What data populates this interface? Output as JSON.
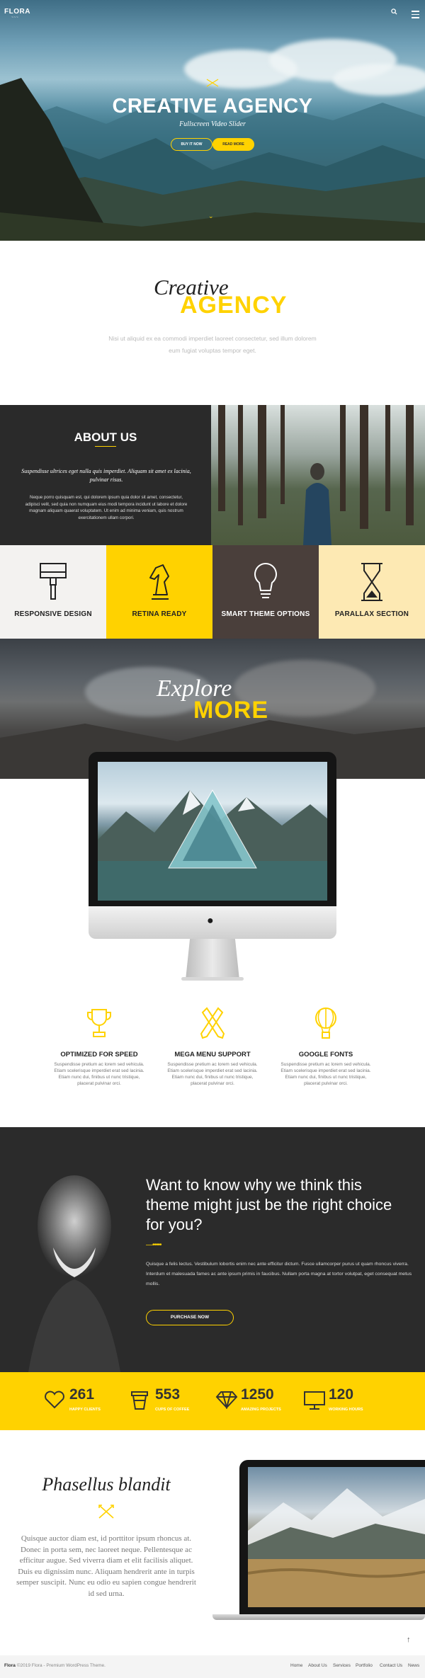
{
  "header": {
    "logo": "FLORA",
    "logo_sub": "~~~",
    "search_icon": "search-icon",
    "menu_icon": "hamburger-icon"
  },
  "hero": {
    "title": "CREATIVE AGENCY",
    "subtitle": "Fullscreen Video Slider",
    "btn_primary": "BUY IT NOW",
    "btn_secondary": "READ MORE",
    "scroll_icon": "chevron-down-icon"
  },
  "creative": {
    "line1": "Creative",
    "line2": "AGENCY",
    "text": "Nisi ut aliquid ex ea commodi imperdiet laoreet consectetur, sed illum dolorem eum fugiat voluptas tempor eget."
  },
  "about": {
    "title": "ABOUT US",
    "subtitle": "Suspendisse ultrices eget nulla quis imperdiet. Aliquam sit amet ex lacinia, pulvinar risus.",
    "body": "Neque porro quisquam est, qui dolorem ipsum quia dolor sit amet, consectetur, adipisci velit, sed quia non numquam eius modi tempora incidunt ut labore et dolore magnam aliquam quaerat voluptatem. Ut enim ad minima veniam, quis nostrum exercitationem ullam corpori."
  },
  "features": [
    {
      "label": "RESPONSIVE DESIGN",
      "icon": "paintbrush-icon",
      "bg": "#f3f2f0",
      "color": "#222"
    },
    {
      "label": "RETINA READY",
      "icon": "chess-knight-icon",
      "bg": "#ffd200",
      "color": "#222"
    },
    {
      "label": "SMART THEME OPTIONS",
      "icon": "lightbulb-icon",
      "bg": "#4a3f3b",
      "color": "#fff"
    },
    {
      "label": "PARALLAX SECTION",
      "icon": "hourglass-icon",
      "bg": "#fde9b3",
      "color": "#222"
    }
  ],
  "explore": {
    "line1": "Explore",
    "line2": "MORE"
  },
  "icon_features": [
    {
      "title": "OPTIMIZED FOR SPEED",
      "icon": "trophy-icon",
      "text": "Suspendisse pretium ac lorem sed vehicula. Etiam scelerisque imperdiet erat sed lacinia. Etiam nunc dui, finibus ut nunc tristique, placerat pulvinar orci."
    },
    {
      "title": "MEGA MENU SUPPORT",
      "icon": "pencil-ruler-icon",
      "text": "Suspendisse pretium ac lorem sed vehicula. Etiam scelerisque imperdiet erat sed lacinia. Etiam nunc dui, finibus ut nunc tristique, placerat pulvinar orci."
    },
    {
      "title": "GOOGLE FONTS",
      "icon": "balloon-icon",
      "text": "Suspendisse pretium ac lorem sed vehicula. Etiam scelerisque imperdiet erat sed lacinia. Etiam nunc dui, finibus ut nunc tristique, placerat pulvinar orci."
    }
  ],
  "quote": {
    "heading": "Want to know why we think this theme might just be the right choice for you?",
    "text": "Quisque a felis lectus. Vestibulum lobortis enim nec ante efficitur dictum. Fusce ullamcorper purus ut quam rhoncus viverra. Interdum et malesuada fames ac ante ipsum primis in faucibus. Nullam porta magna at tortor volutpat, eget consequat metus mollis.",
    "button": "PURCHASE NOW"
  },
  "counters": [
    {
      "value": "261",
      "label": "HAPPY CLIENTS",
      "icon": "heart-icon"
    },
    {
      "value": "553",
      "label": "CUPS OF COFFEE",
      "icon": "coffee-cup-icon"
    },
    {
      "value": "1250",
      "label": "AMAZING PROJECTS",
      "icon": "diamond-icon"
    },
    {
      "value": "120",
      "label": "WORKING HOURS",
      "icon": "monitor-icon"
    }
  ],
  "phasellus": {
    "title": "Phasellus blandit",
    "text": "Quisque auctor diam est, id porttitor ipsum rhoncus at. Donec in porta sem, nec laoreet neque. Pellentesque ac efficitur augue. Sed viverra diam et elit facilisis aliquet. Duis eu dignissim nunc. Aliquam hendrerit ante in turpis semper suscipit. Nunc eu odio eu sapien congue hendrerit id sed urna."
  },
  "footer": {
    "brand": "Flora",
    "copyright": "©2019 Flora - Premium WordPress Theme.",
    "nav": [
      "Home",
      "About Us",
      "Services",
      "Portfolio",
      "Contact Us",
      "News"
    ]
  },
  "colors": {
    "accent": "#ffd200",
    "dark": "#2a2a2a"
  }
}
